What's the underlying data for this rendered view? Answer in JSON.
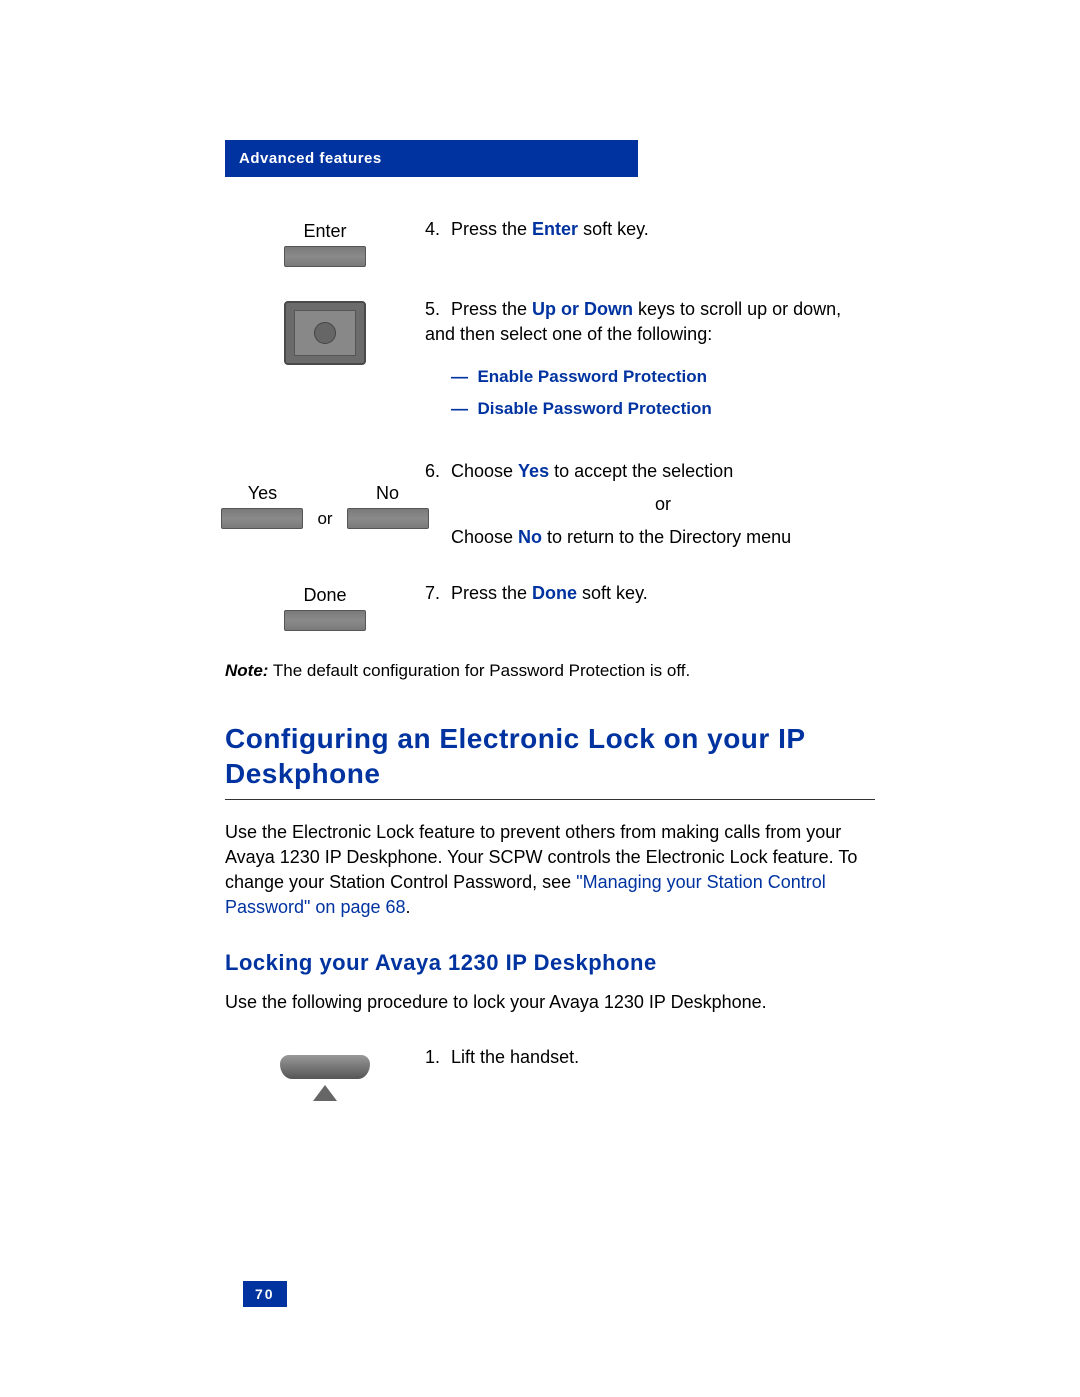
{
  "header": {
    "title": "Advanced features"
  },
  "step4": {
    "label": "Enter",
    "num": "4.",
    "text_before": "Press the ",
    "key": "Enter",
    "text_after": " soft key."
  },
  "step5": {
    "num": "5.",
    "text_before": "Press the ",
    "key": "Up or Down",
    "text_after": " keys to scroll up or down, and then select one of the following:",
    "option1_dash": "—",
    "option1": "Enable Password Protection",
    "option2_dash": "—",
    "option2": "Disable Password Protection"
  },
  "step6": {
    "yes_label": "Yes",
    "no_label": "No",
    "or_label": "or",
    "num": "6.",
    "text_before": "Choose ",
    "yes_key": "Yes",
    "text_mid": " to accept the selection",
    "or_text": "or",
    "text_before2": "Choose ",
    "no_key": "No",
    "text_after": " to return to the Directory menu"
  },
  "step7": {
    "label": "Done",
    "num": "7.",
    "text_before": "Press the ",
    "key": "Done",
    "text_after": " soft key."
  },
  "note": {
    "bold": "Note:",
    "text": " The default configuration for Password Protection is off."
  },
  "section": {
    "heading": "Configuring an Electronic Lock on your IP Deskphone",
    "body_before": "Use the Electronic Lock feature to prevent others from making calls from your Avaya 1230 IP Deskphone. Your SCPW controls the Electronic Lock feature. To change your Station Control Password, see ",
    "link": "\"Managing your Station Control Password\" on page 68",
    "body_after": "."
  },
  "subsection": {
    "heading": "Locking your Avaya 1230 IP Deskphone",
    "text": "Use the following procedure to lock your Avaya 1230 IP Deskphone."
  },
  "step1": {
    "num": "1.",
    "text": "Lift the handset."
  },
  "page_number": "70"
}
